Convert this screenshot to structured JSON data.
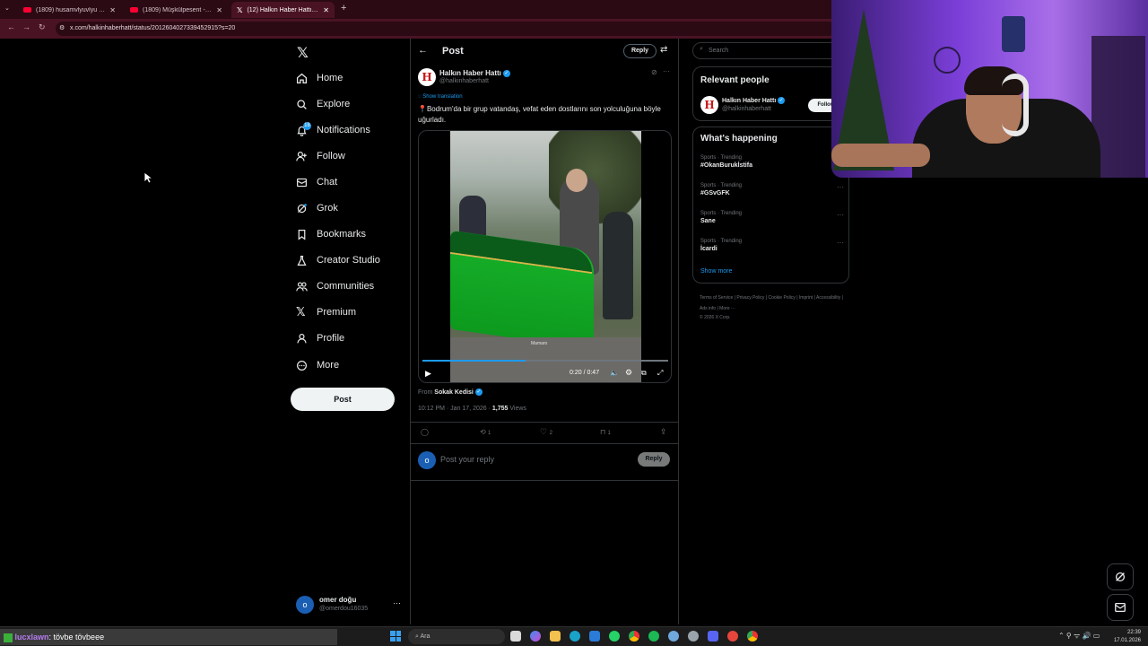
{
  "browser": {
    "tabs": [
      {
        "label": "(1809) husamvlyuvlyu - YouTube"
      },
      {
        "label": "(1809) Müşkülpesent - YouTube"
      },
      {
        "label": "(12) Halkın Haber Hattı on X: \"📍"
      }
    ],
    "url": "x.com/halkinhaberhatt/status/2012604027339452915?s=20"
  },
  "nav": {
    "items": [
      {
        "label": "Home",
        "icon": "home-icon"
      },
      {
        "label": "Explore",
        "icon": "search-icon"
      },
      {
        "label": "Notifications",
        "icon": "bell-icon",
        "badge": "18"
      },
      {
        "label": "Follow",
        "icon": "person-add-icon"
      },
      {
        "label": "Chat",
        "icon": "mail-icon"
      },
      {
        "label": "Grok",
        "icon": "grok-icon"
      },
      {
        "label": "Bookmarks",
        "icon": "bookmark-icon"
      },
      {
        "label": "Creator Studio",
        "icon": "flask-icon"
      },
      {
        "label": "Communities",
        "icon": "people-icon"
      },
      {
        "label": "Premium",
        "icon": "x-logo-icon"
      },
      {
        "label": "Profile",
        "icon": "person-icon"
      },
      {
        "label": "More",
        "icon": "more-circle-icon"
      }
    ],
    "post_button": "Post",
    "account": {
      "name": "omer doğu",
      "handle": "@omerdou16035",
      "initial": "o"
    }
  },
  "post": {
    "header_title": "Post",
    "reply_button": "Reply",
    "author_name": "Halkın Haber Hattı",
    "author_handle": "@halkinhaberhatt",
    "show_translation": "Show translation",
    "text": "📍Bodrum'da  bir grup vatandaş, vefat eden dostlarını son yolculuğuna böyle uğurladı.",
    "video": {
      "time": "0:20 / 0:47",
      "progress": 0.42,
      "watermark": "Mamaro"
    },
    "from_label": "From",
    "from_source": "Sokak Kedisi",
    "timestamp": "10:12 PM · Jan 17, 2026 · ",
    "views_count": "1,755",
    "views_label": " Views",
    "actions": {
      "replies": "",
      "reposts": "1",
      "likes": "2",
      "bookmarks": "1"
    },
    "reply_placeholder": "Post your reply",
    "reply_submit": "Reply",
    "reply_avatar_initial": "o"
  },
  "sidebar": {
    "search_placeholder": "Search",
    "relevant_title": "Relevant people",
    "relevant_name": "Halkın Haber Hattı",
    "relevant_handle": "@halkinhaberhatt",
    "follow_label": "Follow",
    "happening_title": "What's happening",
    "trends": [
      {
        "category": "Sports · Trending",
        "tag": "#OkanBurukİstifa"
      },
      {
        "category": "Sports · Trending",
        "tag": "#GSvGFK"
      },
      {
        "category": "Sports · Trending",
        "tag": "Sane"
      },
      {
        "category": "Sports · Trending",
        "tag": "İcardi"
      }
    ],
    "show_more": "Show more",
    "footer_links": [
      "Terms of Service",
      "Privacy Policy",
      "Cookie Policy",
      "Imprint",
      "Accessibility",
      "Ads info",
      "More ···"
    ],
    "copyright": "© 2026 X Corp."
  },
  "taskbar": {
    "chat_user": "lucxlawn",
    "chat_message": ": tövbe tövbeee",
    "search_placeholder": "Ara",
    "clock_time": "22:39",
    "clock_date": "17.01.2026"
  },
  "colors": {
    "accent": "#1d9bf0",
    "tabbar": "#2b0a14",
    "addressbar": "#4a1323"
  }
}
